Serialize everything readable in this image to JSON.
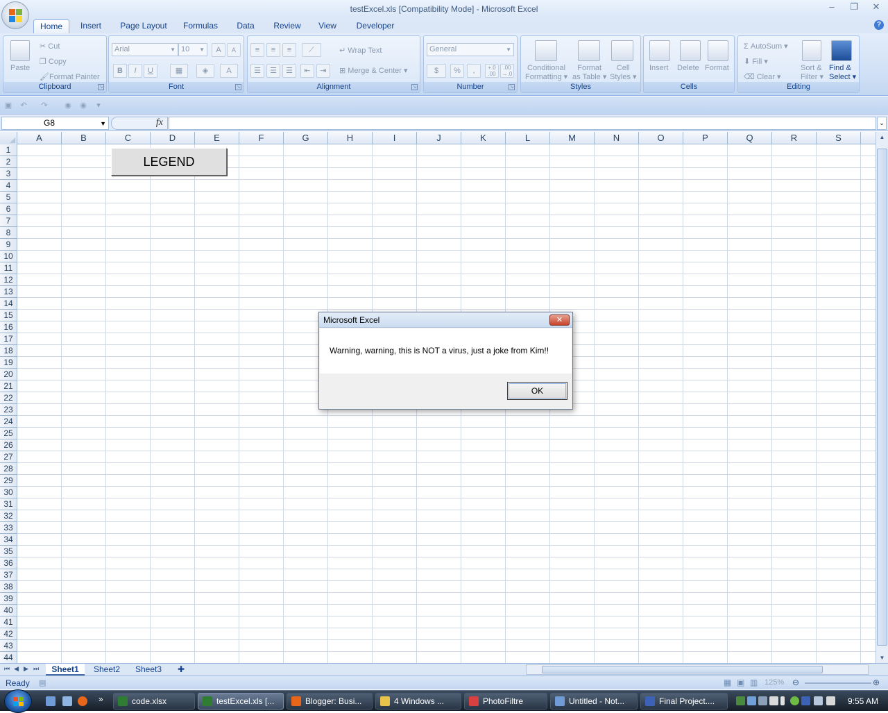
{
  "window": {
    "title": "testExcel.xls  [Compatibility Mode] - Microsoft Excel",
    "controls": [
      "–",
      "❐",
      "✕"
    ]
  },
  "ribbon_tabs": [
    "Home",
    "Insert",
    "Page Layout",
    "Formulas",
    "Data",
    "Review",
    "View",
    "Developer"
  ],
  "active_tab": "Home",
  "ribbon": {
    "clipboard": {
      "label": "Clipboard",
      "paste": "Paste",
      "cut": "Cut",
      "copy": "Copy",
      "format_painter": "Format Painter"
    },
    "font": {
      "label": "Font",
      "font_name": "Arial",
      "font_size": "10",
      "bold": "B",
      "italic": "I",
      "underline": "U"
    },
    "alignment": {
      "label": "Alignment",
      "wrap_text": "Wrap Text",
      "merge_center": "Merge & Center"
    },
    "number": {
      "label": "Number",
      "format": "General",
      "currency": "$",
      "percent": "%",
      "comma": ",",
      "inc_decimal": "+.0\n.00",
      "dec_decimal": ".00\n+.0"
    },
    "styles": {
      "label": "Styles",
      "conditional_1": "Conditional",
      "conditional_2": "Formatting",
      "format_table_1": "Format",
      "format_table_2": "as Table",
      "cell_styles_1": "Cell",
      "cell_styles_2": "Styles"
    },
    "cells": {
      "label": "Cells",
      "insert": "Insert",
      "delete": "Delete",
      "format": "Format"
    },
    "editing": {
      "label": "Editing",
      "autosum": "AutoSum",
      "fill": "Fill",
      "clear": "Clear",
      "sort_1": "Sort &",
      "sort_2": "Filter",
      "find_1": "Find &",
      "find_2": "Select"
    }
  },
  "formula_bar": {
    "name_box": "G8",
    "fx": "fx",
    "value": ""
  },
  "columns": [
    "A",
    "B",
    "C",
    "D",
    "E",
    "F",
    "G",
    "H",
    "I",
    "J",
    "K",
    "L",
    "M",
    "N",
    "O",
    "P",
    "Q",
    "R",
    "S"
  ],
  "rows": [
    "1",
    "2",
    "3",
    "4",
    "5",
    "6",
    "7",
    "8",
    "9",
    "10",
    "11",
    "12",
    "13",
    "14",
    "15",
    "16",
    "17",
    "18",
    "19",
    "20",
    "21",
    "22",
    "23",
    "24",
    "25",
    "26",
    "27",
    "28",
    "29",
    "30",
    "31",
    "32",
    "33",
    "34",
    "35",
    "36",
    "37",
    "38",
    "39",
    "40",
    "41",
    "42",
    "43",
    "44"
  ],
  "legend_button": "LEGEND",
  "sheet_tabs": [
    "Sheet1",
    "Sheet2",
    "Sheet3"
  ],
  "active_sheet": "Sheet1",
  "status": {
    "text": "Ready",
    "zoom": "125%"
  },
  "dialog": {
    "title": "Microsoft Excel",
    "message": "Warning, warning, this is NOT a virus, just a joke from Kim!!",
    "ok": "OK"
  },
  "taskbar": {
    "tasks": [
      {
        "label": "code.xlsx",
        "icon_color": "#2f7d32"
      },
      {
        "label": "testExcel.xls  [...",
        "icon_color": "#2f7d32",
        "active": true
      },
      {
        "label": "Blogger: Busi...",
        "icon_color": "#e8661a"
      },
      {
        "label": "4 Windows ...",
        "icon_color": "#e8c34a"
      },
      {
        "label": "PhotoFiltre",
        "icon_color": "#d94040"
      },
      {
        "label": "Untitled - Not...",
        "icon_color": "#6f9bd6"
      },
      {
        "label": "Final Project....",
        "icon_color": "#3c62b5"
      }
    ],
    "clock": "9:55 AM"
  },
  "colors": {
    "ribbon_bg": "#dbe7f7",
    "taskbar": "#1f2a38",
    "dialog_close": "#c8432a"
  }
}
